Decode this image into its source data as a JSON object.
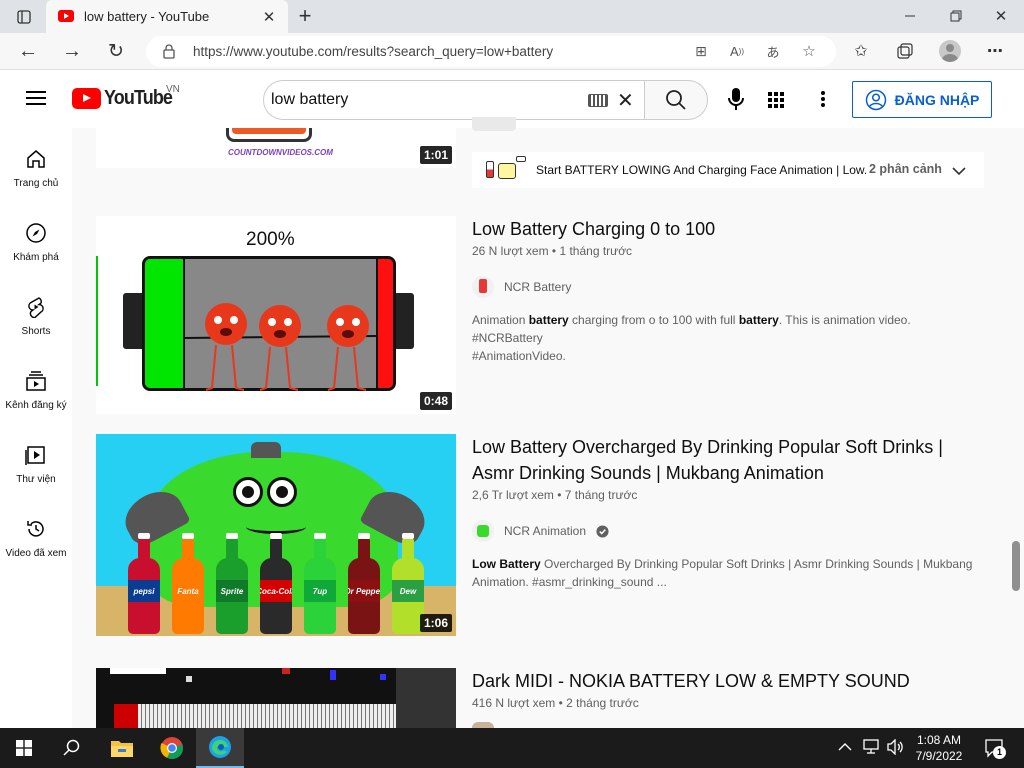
{
  "browser": {
    "tab_title": "low battery - YouTube",
    "url": "https://www.youtube.com/results?search_query=low+battery",
    "new_tab_symbol": "+"
  },
  "youtube": {
    "logo_text": "YouTube",
    "region": "VN",
    "search_value": "low battery",
    "signin_label": "ĐĂNG NHẬP"
  },
  "sidebar": {
    "items": [
      {
        "label": "Trang chủ",
        "icon": "home-icon"
      },
      {
        "label": "Khám phá",
        "icon": "compass-icon"
      },
      {
        "label": "Shorts",
        "icon": "shorts-icon"
      },
      {
        "label": "Kênh đăng ký",
        "icon": "subscriptions-icon"
      },
      {
        "label": "Thư viện",
        "icon": "library-icon"
      },
      {
        "label": "Video đã xem",
        "icon": "history-icon"
      }
    ]
  },
  "results": {
    "top": {
      "duration": "1:01",
      "thumb_caption": "COUNTDOWNVIDEOS.COM",
      "chapter_text": "Start BATTERY LOWING And Charging Face Animation | Low...",
      "chapter_count": "2 phân cảnh"
    },
    "video1": {
      "title": "Low Battery Charging 0 to 100",
      "meta": "26 N lượt xem • 1 tháng trước",
      "channel": "NCR Battery",
      "desc_line1_a": "Animation ",
      "desc_line1_b": "battery",
      "desc_line1_c": " charging from o to 100 with full ",
      "desc_line1_d": "battery",
      "desc_line1_e": ". This is animation video. #NCRBattery",
      "desc_line2": "#AnimationVideo.",
      "duration": "0:48",
      "thumb_text": "200%"
    },
    "video2": {
      "title_line1": "Low Battery Overcharged By Drinking Popular Soft Drinks |",
      "title_line2": "Asmr Drinking Sounds | Mukbang Animation",
      "meta": "2,6 Tr lượt xem • 7 tháng trước",
      "channel": "NCR Animation",
      "desc_bold": "Low Battery",
      "desc_line1": " Overcharged By Drinking Popular Soft Drinks | Asmr Drinking Sounds | Mukbang",
      "desc_line2": "Animation. #asmr_drinking_sound ...",
      "duration": "1:06",
      "bottle_labels": [
        "pepsi",
        "Fanta",
        "Sprite",
        "Coca-Cola",
        "7up",
        "Dr Pepper",
        "Dew"
      ]
    },
    "video3": {
      "title": "Dark MIDI - NOKIA BATTERY LOW & EMPTY SOUND",
      "meta": "416 N lượt xem • 2 tháng trước"
    }
  },
  "taskbar": {
    "time": "1:08 AM",
    "date": "7/9/2022",
    "notification_count": "1"
  },
  "colors": {
    "youtube_red": "#ff0000",
    "link_blue": "#065fd4",
    "battery_green": "#00e600"
  }
}
